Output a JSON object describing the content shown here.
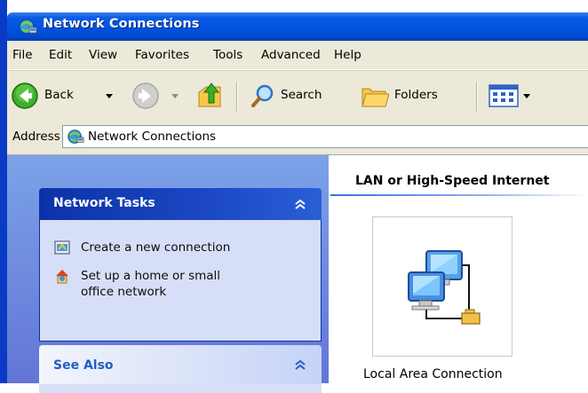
{
  "window": {
    "title": "Network Connections",
    "icon": "network-connections-icon"
  },
  "menu": {
    "items": [
      "File",
      "Edit",
      "View",
      "Favorites",
      "Tools",
      "Advanced",
      "Help"
    ]
  },
  "toolbar": {
    "back_label": "Back",
    "search_label": "Search",
    "folders_label": "Folders"
  },
  "address": {
    "label": "Address",
    "value": "Network Connections"
  },
  "sidebar": {
    "network_tasks": {
      "title": "Network Tasks",
      "items": [
        {
          "label": "Create a new connection",
          "icon": "new-connection-icon"
        },
        {
          "label_line1": "Set up a home or small",
          "label_line2": "office network",
          "icon": "home-network-icon"
        }
      ]
    },
    "see_also": {
      "title": "See Also"
    }
  },
  "content": {
    "group_title": "LAN or High-Speed Internet",
    "connections": [
      {
        "label": "Local Area Connection",
        "icon": "lan-connection-icon"
      }
    ]
  },
  "colors": {
    "title_bar": "#0053e1",
    "task_pane_gradient_top": "#7ba2e7",
    "task_pane_gradient_bottom": "#6375d6",
    "panel_header_dark": "#0c32a8",
    "panel_body": "#d6dff7",
    "chrome": "#ece9d8"
  }
}
